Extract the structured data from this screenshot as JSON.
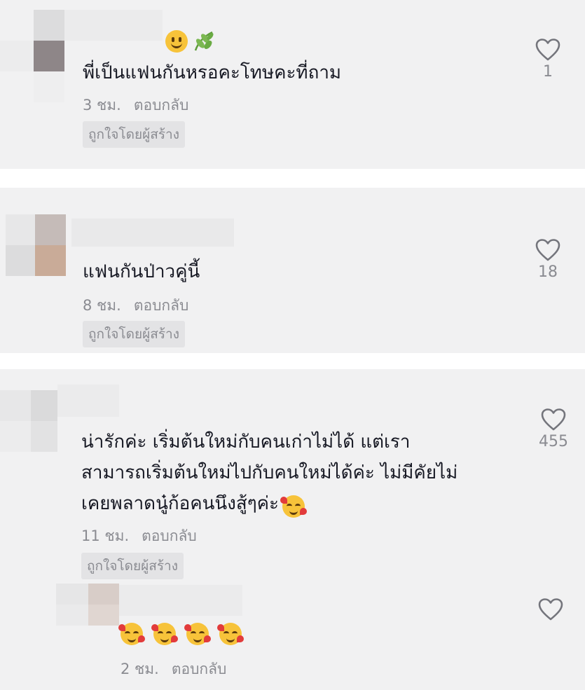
{
  "comments": [
    {
      "text": "พี่เป็นแฟนกันหรอคะโทษคะที่ถาม",
      "time": "3 ชม.",
      "reply": "ตอบกลับ",
      "badge": "ถูกใจโดยผู้สร้าง",
      "likes": "1",
      "name_emojis": [
        "smiling-face-icon",
        "leaf-icon"
      ]
    },
    {
      "text": "แฟนกันป่าวคู่นี้",
      "time": "8 ชม.",
      "reply": "ตอบกลับ",
      "badge": "ถูกใจโดยผู้สร้าง",
      "likes": "18"
    },
    {
      "lines": [
        "น่ารักค่ะ เริ่มต้นใหม่กับคนเก่าไม่ได้ แต่เรา",
        "สามารถเริ่มต้นใหม่ไปกับคนใหม่ได้ค่ะ ไม่มีคัยไม่",
        "เคยพลาดนู๋ก้อคนนึงสู้ๆค่ะ"
      ],
      "time": "11 ชม.",
      "reply": "ตอบกลับ",
      "badge": "ถูกใจโดยผู้สร้าง",
      "likes": "455",
      "trailing_emoji": "smiling-face-with-hearts-icon"
    },
    {
      "emojis": [
        "smiling-face-with-hearts-icon",
        "smiling-face-with-hearts-icon",
        "smiling-face-with-hearts-icon",
        "smiling-face-with-hearts-icon"
      ],
      "time": "2 ชม.",
      "reply": "ตอบกลับ"
    }
  ],
  "colors": {
    "card_bg": "#f1f1f2",
    "text": "#161823",
    "muted": "#8a8b91",
    "badge_bg": "#e3e3e5"
  }
}
